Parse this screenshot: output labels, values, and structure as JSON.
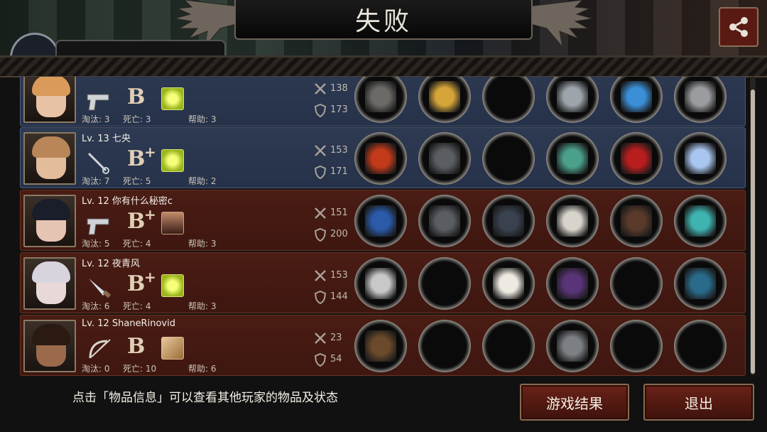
{
  "header": {
    "title": "失败",
    "share_icon": "share-icon"
  },
  "players": [
    {
      "name": "",
      "weapon_icon": "pistol-icon",
      "grade": "B",
      "grade_plus": "",
      "trait": "green-gem",
      "kills_label": "淘汰: 3",
      "deaths_label": "死亡: 3",
      "assists_label": "帮助: 3",
      "attack": "138",
      "defense": "173",
      "style": "blue",
      "equipment": [
        "minigun",
        "crown",
        "",
        "spiked-armor",
        "blue-shoes",
        "flag-spear"
      ]
    },
    {
      "name": "Lv. 13 七央",
      "weapon_icon": "rapier-icon",
      "grade": "B",
      "grade_plus": "+",
      "trait": "green-gem",
      "kills_label": "淘汰: 7",
      "deaths_label": "死亡: 5",
      "assists_label": "帮助: 2",
      "attack": "153",
      "defense": "171",
      "style": "blue",
      "equipment": [
        "fire-spear",
        "skull-helmet",
        "",
        "jade-bracelet",
        "red-heels",
        "ice-crystal"
      ]
    },
    {
      "name": "Lv. 12 你有什么秘密c",
      "weapon_icon": "pistol-icon",
      "grade": "B",
      "grade_plus": "+",
      "trait": "portrait-small",
      "kills_label": "淘汰: 5",
      "deaths_label": "死亡: 4",
      "assists_label": "帮助: 3",
      "attack": "151",
      "defense": "200",
      "style": "red",
      "equipment": [
        "blue-rifle",
        "skull-helmet",
        "dark-armor",
        "feather-blade",
        "boots",
        "dragon-eye"
      ]
    },
    {
      "name": "Lv. 12 夜青风",
      "weapon_icon": "knife-icon",
      "grade": "B",
      "grade_plus": "+",
      "trait": "green-gem",
      "kills_label": "淘汰: 6",
      "deaths_label": "死亡: 4",
      "assists_label": "帮助: 3",
      "attack": "153",
      "defense": "144",
      "style": "red",
      "equipment": [
        "scythe",
        "",
        "white-coat",
        "purple-gauntlet",
        "",
        "teal-gem"
      ]
    },
    {
      "name": "Lv. 12 ShaneRinovid",
      "weapon_icon": "bow-icon",
      "grade": "B",
      "grade_plus": "",
      "trait": "map",
      "kills_label": "淘汰: 0",
      "deaths_label": "死亡: 10",
      "assists_label": "帮助: 6",
      "attack": "23",
      "defense": "54",
      "style": "red",
      "equipment": [
        "bow",
        "",
        "",
        "steel-shield",
        "",
        ""
      ]
    }
  ],
  "footer": {
    "hint": "点击「物品信息」可以查看其他玩家的物品及状态",
    "result_button": "游戏结果",
    "exit_button": "退出"
  },
  "colors": {
    "blue_row": "#2e3a52",
    "red_row": "#4a1c14",
    "button": "#6a2218"
  }
}
